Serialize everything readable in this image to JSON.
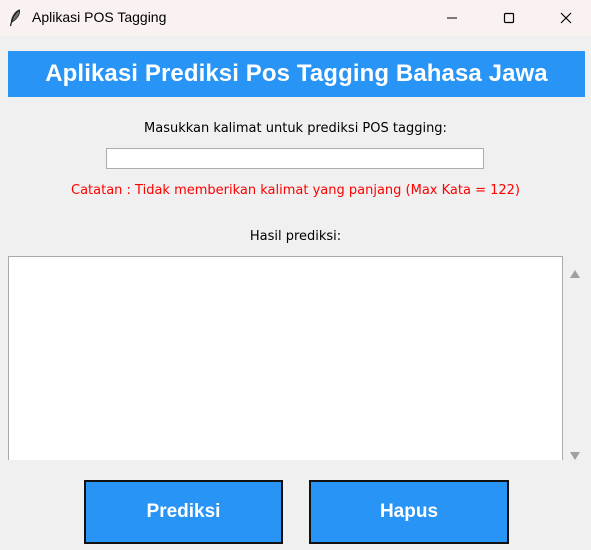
{
  "window": {
    "title": "Aplikasi POS Tagging",
    "icon": "feather-icon",
    "controls": [
      "minimize-icon",
      "maximize-icon",
      "close-icon"
    ]
  },
  "header": {
    "title": "Aplikasi Prediksi Pos Tagging Bahasa Jawa"
  },
  "input": {
    "label": "Masukkan kalimat untuk prediksi POS tagging:",
    "value": "",
    "placeholder": ""
  },
  "note": {
    "text": "Catatan : Tidak memberikan kalimat yang panjang (Max Kata = 122)"
  },
  "result": {
    "label": "Hasil prediksi:",
    "value": ""
  },
  "buttons": {
    "predict_label": "Prediksi",
    "clear_label": "Hapus"
  },
  "colors": {
    "accent": "#2894f5",
    "note": "#ff0000",
    "titlebar": "#f9f2f1",
    "background": "#f0f0f0"
  }
}
